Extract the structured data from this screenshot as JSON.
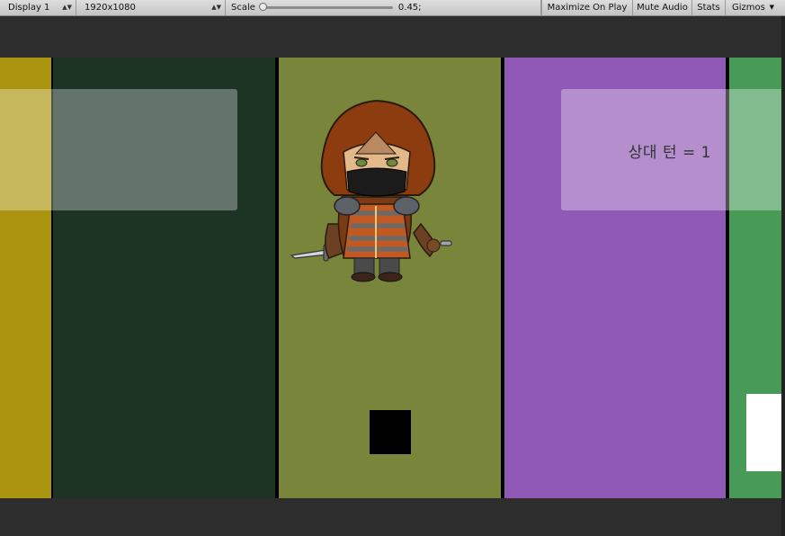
{
  "toolbar": {
    "display": "Display 1",
    "resolution": "1920x1080",
    "scale_label": "Scale",
    "scale_value": "0.45;",
    "maximize_label": "Maximize On Play",
    "mute_label": "Mute Audio",
    "stats_label": "Stats",
    "gizmos_label": "Gizmos"
  },
  "game": {
    "turn_text": "상대 턴 = 1",
    "lanes": [
      {
        "color": "#ab9510"
      },
      {
        "color": "#1d3324"
      },
      {
        "color": "#7a853c"
      },
      {
        "color": "#9159b6"
      },
      {
        "color": "#479b57"
      }
    ],
    "character_icon": "hooded-rogue-character"
  }
}
